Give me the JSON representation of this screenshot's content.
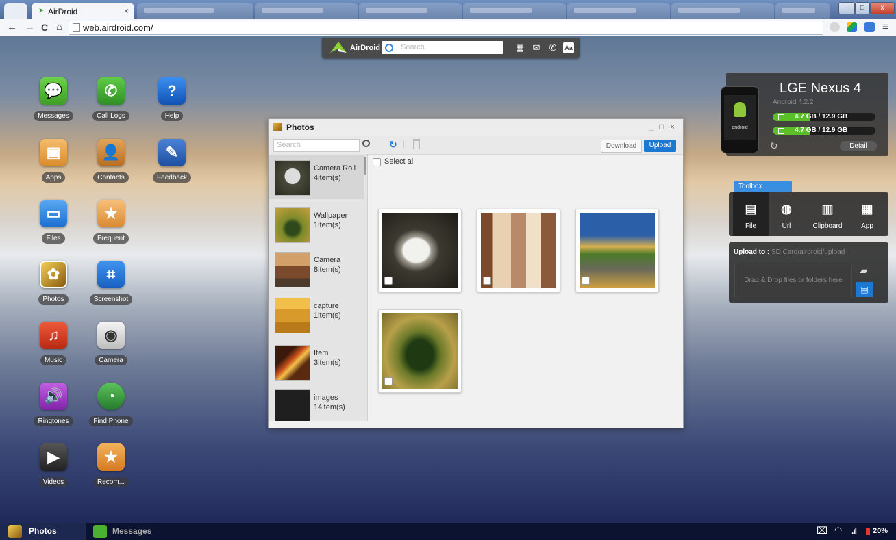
{
  "browser": {
    "active_tab_title": "AirDroid",
    "active_tab_close": "×",
    "url": "web.airdroid.com/",
    "nav": {
      "back": "←",
      "forward": "→",
      "reload": "C",
      "home": "⌂"
    },
    "window_buttons": {
      "minimize": "–",
      "maximize": "□",
      "close": "x"
    },
    "menu_glyph": "≡"
  },
  "topbar": {
    "brand": "AirDroid",
    "search_placeholder": "Search"
  },
  "desktop_apps": [
    {
      "label": "Messages",
      "color": "#5bbf3a",
      "glyph": "💬"
    },
    {
      "label": "Call Logs",
      "color": "#4cae3a",
      "glyph": "✆"
    },
    {
      "label": "Help",
      "color": "#1e6fd0",
      "glyph": "?"
    },
    {
      "label": "Apps",
      "color": "#e7a24a",
      "glyph": "▣"
    },
    {
      "label": "Contacts",
      "color": "#d38a33",
      "glyph": "👤"
    },
    {
      "label": "Feedback",
      "color": "#2f63b8",
      "glyph": "✎"
    },
    {
      "label": "Files",
      "color": "#3a8ee0",
      "glyph": "▭"
    },
    {
      "label": "Frequent",
      "color": "#e8a85a",
      "glyph": "★"
    },
    {
      "label": "Photos",
      "color": "#b88a2a",
      "glyph": "✿"
    },
    {
      "label": "Screenshot",
      "color": "#2b7fd6",
      "glyph": "⌗"
    },
    {
      "label": "Music",
      "color": "#d83c25",
      "glyph": "♫"
    },
    {
      "label": "Camera",
      "color": "#dddddd",
      "glyph": "◉"
    },
    {
      "label": "Ringtones",
      "color": "#a341c5",
      "glyph": "🔊"
    },
    {
      "label": "Find Phone",
      "color": "#3f9a44",
      "glyph": "◔"
    },
    {
      "label": "Videos",
      "color": "#4a4a4a",
      "glyph": "▶"
    },
    {
      "label": "Recom...",
      "color": "#e69a3a",
      "glyph": "★"
    }
  ],
  "photos_window": {
    "title": "Photos",
    "window_controls": {
      "minimize": "_",
      "maximize": "□",
      "close": "×"
    },
    "search_placeholder": "Search",
    "download_label": "Download",
    "upload_label": "Upload",
    "select_all_label": "Select all",
    "albums": [
      {
        "name": "Camera Roll",
        "count": "4item(s)"
      },
      {
        "name": "Wallpaper",
        "count": "1item(s)"
      },
      {
        "name": "Camera",
        "count": "8item(s)"
      },
      {
        "name": "capture",
        "count": "1item(s)"
      },
      {
        "name": "Item",
        "count": "3item(s)"
      },
      {
        "name": "images",
        "count": "14item(s)"
      }
    ]
  },
  "device": {
    "model": "LGE Nexus 4",
    "android_version": "Android 4.2.2",
    "storage": [
      {
        "used": "4.7",
        "rest": "GB / 12.9 GB",
        "fraction": 0.36
      },
      {
        "used": "4.7",
        "rest": "GB / 12.9 GB",
        "fraction": 0.36
      }
    ],
    "detail_label": "Detail",
    "phone_text": "android"
  },
  "toolbox": {
    "title": "Toolbox",
    "tools": [
      {
        "label": "File",
        "glyph": "▤"
      },
      {
        "label": "Url",
        "glyph": "◍"
      },
      {
        "label": "Clipboard",
        "glyph": "▥"
      },
      {
        "label": "App",
        "glyph": "▦"
      }
    ],
    "upload_to_label": "Upload to :",
    "upload_path": "SD Card/airdroid/upload",
    "dropzone_text": "Drag & Drop files or folders here"
  },
  "taskbar": {
    "items": [
      {
        "label": "Photos"
      },
      {
        "label": "Messages"
      }
    ],
    "battery": "20%"
  }
}
